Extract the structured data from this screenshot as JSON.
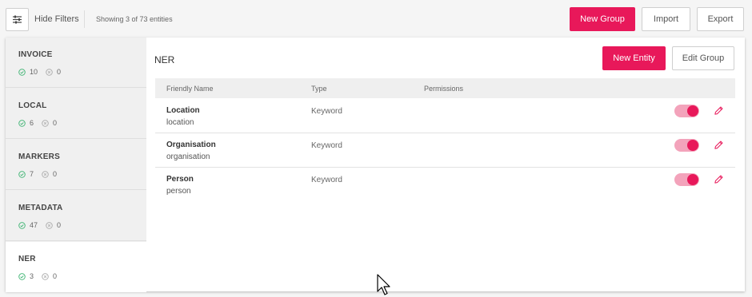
{
  "toolbar": {
    "filter_icon": "sliders-icon",
    "hide_filters_label": "Hide Filters",
    "showing_text": "Showing 3 of 73 entities",
    "new_group_label": "New Group",
    "import_label": "Import",
    "export_label": "Export"
  },
  "colors": {
    "accent": "#e8185a",
    "toggle_track": "#f3a3bb",
    "check_green": "#3cb371"
  },
  "groups": [
    {
      "name": "INVOICE",
      "enabled": "10",
      "disabled": "0"
    },
    {
      "name": "LOCAL",
      "enabled": "6",
      "disabled": "0"
    },
    {
      "name": "MARKERS",
      "enabled": "7",
      "disabled": "0"
    },
    {
      "name": "METADATA",
      "enabled": "47",
      "disabled": "0"
    },
    {
      "name": "NER",
      "enabled": "3",
      "disabled": "0"
    }
  ],
  "content": {
    "title": "NER",
    "new_entity_label": "New Entity",
    "edit_group_label": "Edit Group",
    "columns": [
      "Friendly Name",
      "Type",
      "Permissions"
    ],
    "rows": [
      {
        "name": "Location",
        "id": "location",
        "type": "Keyword",
        "enabled": true
      },
      {
        "name": "Organisation",
        "id": "organisation",
        "type": "Keyword",
        "enabled": true
      },
      {
        "name": "Person",
        "id": "person",
        "type": "Keyword",
        "enabled": true
      }
    ]
  }
}
